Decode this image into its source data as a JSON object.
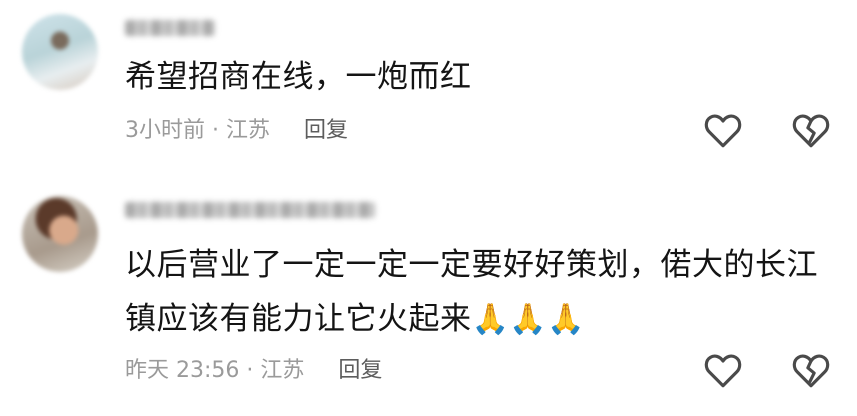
{
  "comments": [
    {
      "username_redacted": true,
      "text": "希望招商在线，一炮而红",
      "meta": "3小时前 · 江苏",
      "reply_label": "回复",
      "icons": [
        "heart-outline-icon",
        "broken-heart-outline-icon"
      ]
    },
    {
      "username_redacted": true,
      "text_line1": "以后营业了一定一定一定要好好策划，偌大的长江",
      "text_line2": "镇应该有能力让它火起来",
      "emoji": "🙏🙏🙏",
      "meta": "昨天 23:56 · 江苏",
      "reply_label": "回复",
      "icons": [
        "heart-outline-icon",
        "broken-heart-outline-icon"
      ]
    }
  ],
  "colors": {
    "text": "#141414",
    "meta": "#9a9a9a",
    "reply": "#5d5d5d",
    "icon_stroke": "#4a4a4a"
  }
}
